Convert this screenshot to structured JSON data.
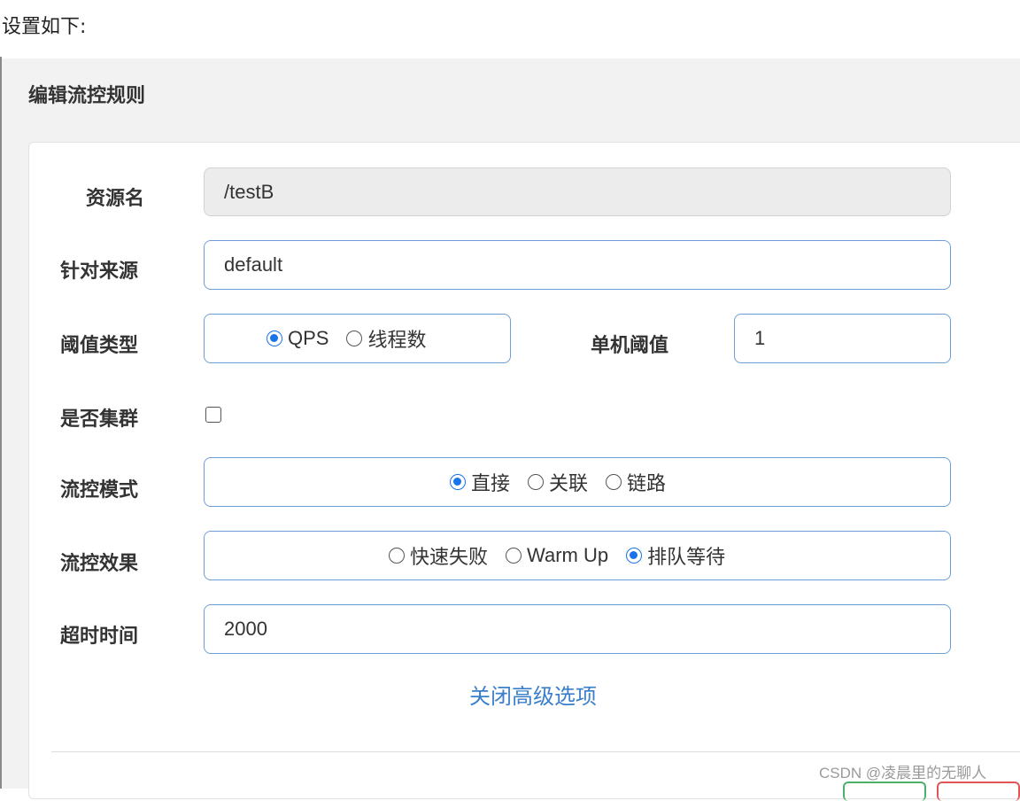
{
  "intro_text": "设置如下:",
  "dialog": {
    "title": "编辑流控规则",
    "resource": {
      "label": "资源名",
      "value": "/testB"
    },
    "source": {
      "label": "针对来源",
      "value": "default"
    },
    "threshold_type": {
      "label": "阈值类型",
      "options": [
        "QPS",
        "线程数"
      ],
      "selected": "QPS"
    },
    "single_threshold": {
      "label": "单机阈值",
      "value": "1"
    },
    "cluster": {
      "label": "是否集群",
      "checked": false
    },
    "flow_mode": {
      "label": "流控模式",
      "options": [
        "直接",
        "关联",
        "链路"
      ],
      "selected": "直接"
    },
    "flow_effect": {
      "label": "流控效果",
      "options": [
        "快速失败",
        "Warm Up",
        "排队等待"
      ],
      "selected": "排队等待"
    },
    "timeout": {
      "label": "超时时间",
      "value": "2000"
    },
    "advanced_toggle": "关闭高级选项"
  },
  "watermark": "CSDN @凌晨里的无聊人",
  "colors": {
    "accent": "#1a73e8",
    "input_border": "#6d9ed6",
    "link": "#3a7fcb",
    "save_button": "#4caf6a",
    "cancel_button": "#e05555"
  }
}
